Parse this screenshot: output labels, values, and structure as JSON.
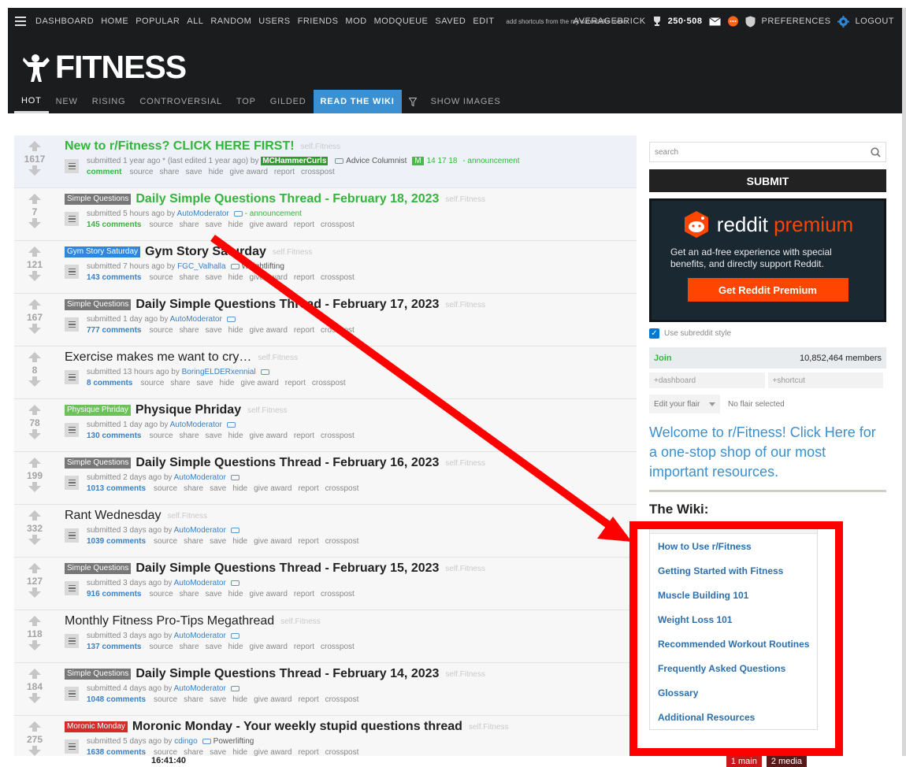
{
  "topbar": {
    "menu": [
      "DASHBOARD",
      "HOME",
      "POPULAR",
      "ALL",
      "RANDOM",
      "USERS",
      "FRIENDS",
      "MOD",
      "MODQUEUE",
      "SAVED",
      "EDIT"
    ],
    "hint": "add shortcuts from the my subreddits menu",
    "username": "AVERAGEBRICK",
    "karma": "250·508",
    "preferences": "PREFERENCES",
    "logout": "LOGOUT"
  },
  "logo": "FITNESS",
  "tabs": [
    "HOT",
    "NEW",
    "RISING",
    "CONTROVERSIAL",
    "TOP",
    "GILDED",
    "READ THE WIKI",
    "SHOW IMAGES"
  ],
  "posts": [
    {
      "score": "1617",
      "flair": "",
      "title": "New to r/Fitness? CLICK HERE FIRST!",
      "domain": "self.Fitness",
      "meta_pre": "submitted 1 year ago * (last edited 1 year ago) by",
      "author": "MCHammerCurls",
      "extra": "Advice Columnist",
      "awards": "14  17  18",
      "tag": "- announcement",
      "comments": "comment"
    },
    {
      "score": "7",
      "flair": "Simple Questions",
      "title": "Daily Simple Questions Thread - February 18, 2023",
      "domain": "self.Fitness",
      "meta_pre": "submitted 5 hours ago by",
      "author": "AutoModerator",
      "tag": "- announcement",
      "comments": "145 comments"
    },
    {
      "score": "121",
      "flair": "Gym Story Saturday",
      "title": "Gym Story Saturday",
      "domain": "self.Fitness",
      "meta_pre": "submitted 7 hours ago by",
      "author": "FGC_Valhalla",
      "tag": "Weightlifting",
      "comments": "143 comments"
    },
    {
      "score": "167",
      "flair": "Simple Questions",
      "title": "Daily Simple Questions Thread - February 17, 2023",
      "domain": "self.Fitness",
      "meta_pre": "submitted 1 day ago by",
      "author": "AutoModerator",
      "tag": "",
      "comments": "777 comments"
    },
    {
      "score": "8",
      "flair": "",
      "title": "Exercise makes me want to cry…",
      "domain": "self.Fitness",
      "meta_pre": "submitted 13 hours ago by",
      "author": "BoringELDERxennial",
      "tag": "",
      "comments": "8 comments"
    },
    {
      "score": "78",
      "flair": "Physique Phriday",
      "title": "Physique Phriday",
      "domain": "self.Fitness",
      "meta_pre": "submitted 1 day ago by",
      "author": "AutoModerator",
      "tag": "",
      "comments": "130 comments"
    },
    {
      "score": "199",
      "flair": "Simple Questions",
      "title": "Daily Simple Questions Thread - February 16, 2023",
      "domain": "self.Fitness",
      "meta_pre": "submitted 2 days ago by",
      "author": "AutoModerator",
      "tag": "",
      "comments": "1013 comments"
    },
    {
      "score": "332",
      "flair": "",
      "title": "Rant Wednesday",
      "domain": "self.Fitness",
      "meta_pre": "submitted 3 days ago by",
      "author": "AutoModerator",
      "tag": "",
      "comments": "1039 comments"
    },
    {
      "score": "127",
      "flair": "Simple Questions",
      "title": "Daily Simple Questions Thread - February 15, 2023",
      "domain": "self.Fitness",
      "meta_pre": "submitted 3 days ago by",
      "author": "AutoModerator",
      "tag": "",
      "comments": "916 comments"
    },
    {
      "score": "118",
      "flair": "",
      "title": "Monthly Fitness Pro-Tips Megathread",
      "domain": "self.Fitness",
      "meta_pre": "submitted 3 days ago by",
      "author": "AutoModerator",
      "tag": "",
      "comments": "137 comments"
    },
    {
      "score": "184",
      "flair": "Simple Questions",
      "title": "Daily Simple Questions Thread - February 14, 2023",
      "domain": "self.Fitness",
      "meta_pre": "submitted 4 days ago by",
      "author": "AutoModerator",
      "tag": "",
      "comments": "1048 comments"
    },
    {
      "score": "275",
      "flair": "Moronic Monday",
      "title": "Moronic Monday - Your weekly stupid questions thread",
      "domain": "self.Fitness",
      "meta_pre": "submitted 5 days ago by",
      "author": "cdingo",
      "tag": "Powerlifting",
      "comments": "1638 comments"
    }
  ],
  "actions": [
    "source",
    "share",
    "save",
    "hide",
    "give award",
    "report",
    "crosspost"
  ],
  "sidebar": {
    "search_placeholder": "search",
    "submit": "SUBMIT",
    "premium_word": "reddit",
    "premium_accent": "premium",
    "premium_text": "Get an ad-free experience with special benefits, and directly support Reddit.",
    "premium_btn": "Get Reddit Premium",
    "use_style": "Use subreddit style",
    "join": "Join",
    "members": "10,852,464 members",
    "shortcut1": "+dashboard",
    "shortcut2": "+shortcut",
    "flair_label": "Edit your flair",
    "flair_value": "No flair selected",
    "welcome": "Welcome to r/Fitness! Click Here for a one-stop shop of our most important resources.",
    "wiki_heading": "The Wiki:",
    "wiki_items": [
      "How to Use r/Fitness",
      "Getting Started with Fitness",
      "Muscle Building 101",
      "Weight Loss 101",
      "Recommended Workout Routines",
      "Frequently Asked Questions",
      "Glossary",
      "Additional Resources"
    ]
  },
  "taskbar": {
    "clock": "16:41:40",
    "ws1": "1 main",
    "ws2": "2 media"
  },
  "colors": {
    "flair_simple": "#777777",
    "flair_gym": "#2e86de",
    "flair_physique": "#6ac259",
    "flair_moronic": "#d62b2b",
    "annotation": "#ff0000"
  }
}
